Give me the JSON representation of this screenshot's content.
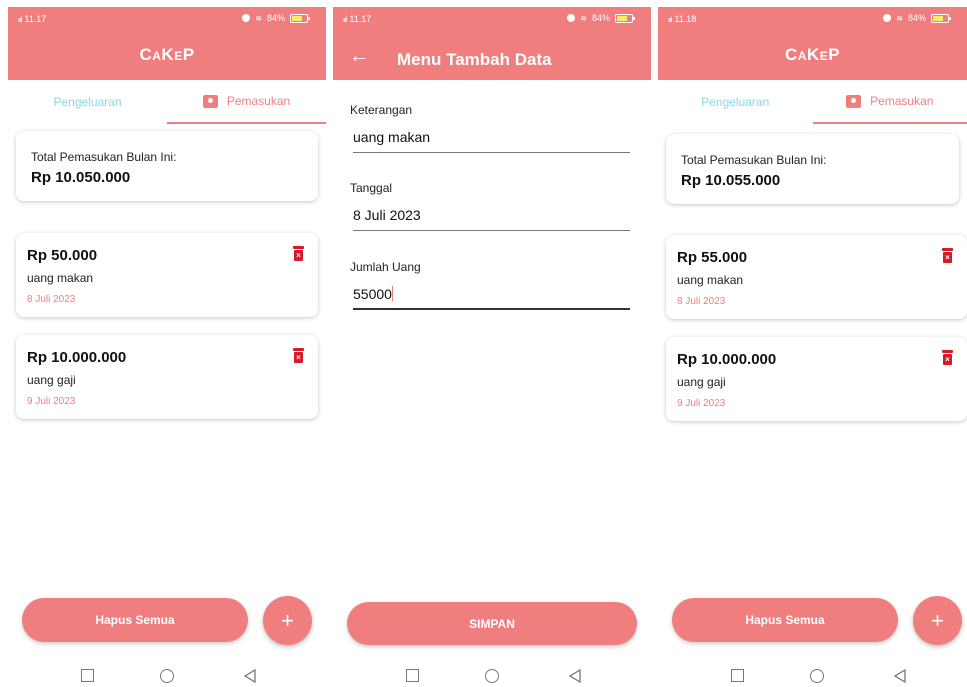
{
  "app": {
    "title": "CaKeP",
    "accent_color": "#F07E7E",
    "tab_inactive_color": "#8CD7E3"
  },
  "screen1": {
    "status": {
      "signal": "ıııl",
      "time": "11.17",
      "battery": "84%"
    },
    "tabs": {
      "left": "Pengeluaran",
      "right": "Pemasukan"
    },
    "total": {
      "label": "Total Pemasukan Bulan Ini:",
      "value": "Rp 10.050.000"
    },
    "items": [
      {
        "amount": "Rp 50.000",
        "desc": "uang makan",
        "date": "8 Juli 2023"
      },
      {
        "amount": "Rp 10.000.000",
        "desc": "uang gaji",
        "date": "9 Juli 2023"
      }
    ],
    "hapus_label": "Hapus Semua",
    "fab_label": "+"
  },
  "screen2": {
    "status": {
      "signal": "ıııl",
      "time": "11.17",
      "battery": "84%"
    },
    "title": "Menu Tambah Data",
    "fields": [
      {
        "label": "Keterangan",
        "value": "uang makan"
      },
      {
        "label": "Tanggal",
        "value": "8 Juli 2023"
      },
      {
        "label": "Jumlah Uang",
        "value": "55000"
      }
    ],
    "simpan_label": "SIMPAN"
  },
  "screen3": {
    "status": {
      "signal": "ıııl",
      "time": "11.18",
      "battery": "84%"
    },
    "tabs": {
      "left": "Pengeluaran",
      "right": "Pemasukan"
    },
    "total": {
      "label": "Total Pemasukan Bulan Ini:",
      "value": "Rp 10.055.000"
    },
    "items": [
      {
        "amount": "Rp 55.000",
        "desc": "uang makan",
        "date": "8 Juli 2023"
      },
      {
        "amount": "Rp 10.000.000",
        "desc": "uang gaji",
        "date": "9 Juli 2023"
      }
    ],
    "hapus_label": "Hapus Semua",
    "fab_label": "+"
  }
}
